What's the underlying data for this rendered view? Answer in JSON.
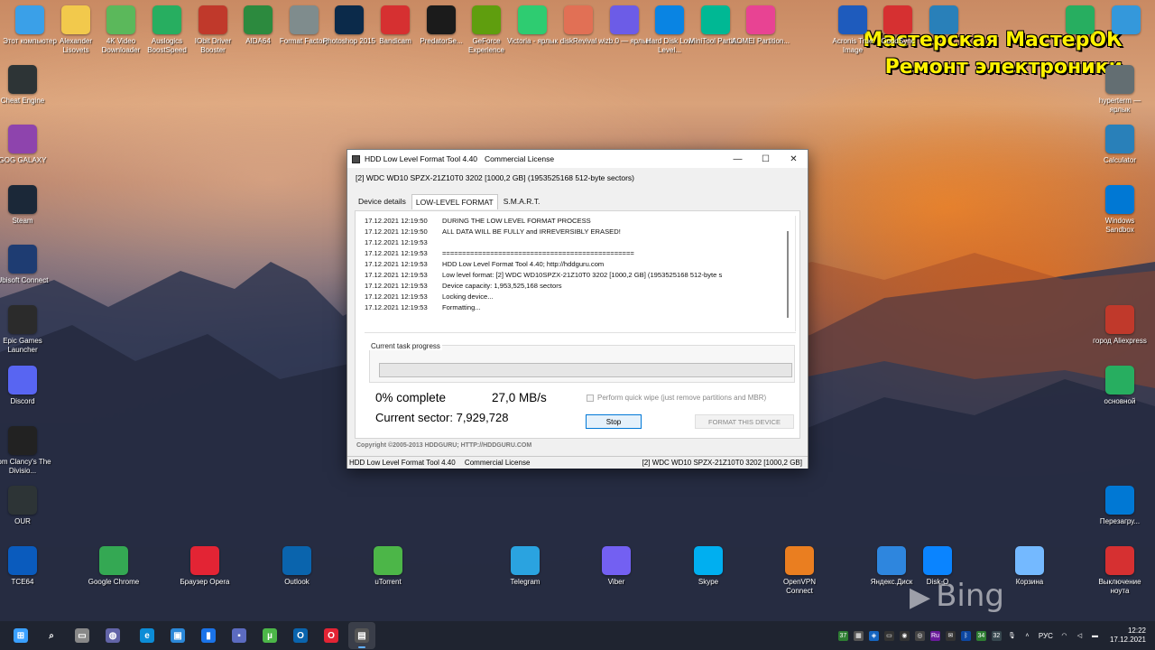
{
  "watermark": {
    "line1": "Мастерская МастерОК",
    "line2": "Ремонт электроники"
  },
  "bing_label": "Bing",
  "desktop_icons": [
    {
      "label": "Этот компьютер",
      "icon": "computer-icon",
      "color": "#3aa0e8"
    },
    {
      "label": "Alexander Lisovets",
      "icon": "folder-icon",
      "color": "#f2c94c"
    },
    {
      "label": "4K Video Downloader",
      "icon": "download-icon",
      "color": "#5bb85b"
    },
    {
      "label": "Auslogics BoostSpeed",
      "icon": "gauge-icon",
      "color": "#27ae60"
    },
    {
      "label": "IObit Driver Booster",
      "icon": "driver-icon",
      "color": "#c0392b"
    },
    {
      "label": "AIDA64",
      "icon": "aida-icon",
      "color": "#2c8a3e"
    },
    {
      "label": "Format Factory",
      "icon": "factory-icon",
      "color": "#7f8c8d"
    },
    {
      "label": "Photoshop 2015",
      "icon": "photoshop-icon",
      "color": "#0b2a4a"
    },
    {
      "label": "Bandicam",
      "icon": "bandicam-icon",
      "color": "#d63031"
    },
    {
      "label": "PredatorSe...",
      "icon": "predator-icon",
      "color": "#1b1b1b"
    },
    {
      "label": "GeForce Experience",
      "icon": "nvidia-icon",
      "color": "#5f9e0e"
    },
    {
      "label": "Victoria - ярлык",
      "icon": "cross-icon",
      "color": "#2ecc71"
    },
    {
      "label": "diskRevival",
      "icon": "disk-revival-icon",
      "color": "#e17055"
    },
    {
      "label": "wizb.0 — ярлык",
      "icon": "wizard-icon",
      "color": "#6c5ce7"
    },
    {
      "label": "Hard Disk Low Level...",
      "icon": "hdd-icon",
      "color": "#0984e3"
    },
    {
      "label": "MiniTool Partiti...",
      "icon": "minitool-icon",
      "color": "#00b894"
    },
    {
      "label": "AOMEI Partition...",
      "icon": "aomei-icon",
      "color": "#e84393"
    },
    {
      "label": "Acronis True Image",
      "icon": "acronis-icon",
      "color": "#1e5bbd"
    },
    {
      "label": "GoodSync",
      "icon": "goodsync-icon",
      "color": "#d63031"
    },
    {
      "label": "",
      "icon": "folder-blue-icon",
      "color": "#2980b9"
    },
    {
      "label": "",
      "icon": "file-green-icon",
      "color": "#27ae60"
    },
    {
      "label": "",
      "icon": "control-icon",
      "color": "#3498db"
    }
  ],
  "left_icons": [
    {
      "label": "Cheat Engine",
      "icon": "cheat-engine-icon",
      "color": "#2d3436"
    },
    {
      "label": "GOG GALAXY",
      "icon": "gog-icon",
      "color": "#8e44ad"
    },
    {
      "label": "Steam",
      "icon": "steam-icon",
      "color": "#1b2838"
    },
    {
      "label": "Ubisoft Connect",
      "icon": "ubisoft-icon",
      "color": "#1e3c72"
    },
    {
      "label": "Epic Games Launcher",
      "icon": "epic-icon",
      "color": "#2b2b2b"
    },
    {
      "label": "Discord",
      "icon": "discord-icon",
      "color": "#5865f2"
    },
    {
      "label": "Tom Clancy's The Divisio...",
      "icon": "division-icon",
      "color": "#222222"
    },
    {
      "label": "OUR",
      "icon": "our-icon",
      "color": "#2d3436"
    },
    {
      "label": "TCE64",
      "icon": "tce-icon",
      "color": "#0a5bbd"
    }
  ],
  "right_icons": [
    {
      "label": "hyperterm — ярлык",
      "icon": "hyperterm-icon",
      "color": "#636e72"
    },
    {
      "label": "Calculator",
      "icon": "calculator-icon",
      "color": "#2980b9"
    },
    {
      "label": "Windows Sandbox",
      "icon": "sandbox-icon",
      "color": "#0078d4"
    },
    {
      "label": "город Aliexpress",
      "icon": "archive-icon",
      "color": "#c0392b"
    },
    {
      "label": "основной",
      "icon": "archive2-icon",
      "color": "#27ae60"
    },
    {
      "label": "Перезагру...",
      "icon": "power-icon",
      "color": "#0078d4"
    },
    {
      "label": "Выключение ноута",
      "icon": "shutdown-icon",
      "color": "#d63031"
    }
  ],
  "bottom_icons": [
    {
      "label": "Google Chrome",
      "icon": "chrome-icon",
      "color": "#34a853"
    },
    {
      "label": "Браузер Opera",
      "icon": "opera-icon",
      "color": "#e32434"
    },
    {
      "label": "Outlook",
      "icon": "outlook-icon",
      "color": "#0a64ad"
    },
    {
      "label": "uTorrent",
      "icon": "utorrent-icon",
      "color": "#4cb648"
    },
    {
      "label": "Telegram",
      "icon": "telegram-icon",
      "color": "#2aa3e0"
    },
    {
      "label": "Viber",
      "icon": "viber-icon",
      "color": "#7360f2"
    },
    {
      "label": "Skype",
      "icon": "skype-icon",
      "color": "#00aff0"
    },
    {
      "label": "OpenVPN Connect",
      "icon": "openvpn-icon",
      "color": "#ea7e20"
    },
    {
      "label": "Яндекс.Диск",
      "icon": "yandex-disk-icon",
      "color": "#2e86de"
    },
    {
      "label": "Disk-O",
      "icon": "disk-o-icon",
      "color": "#0a84ff"
    },
    {
      "label": "Корзина",
      "icon": "recycle-bin-icon",
      "color": "#74b9ff"
    }
  ],
  "window": {
    "title": "HDD Low Level Format Tool 4.40",
    "license": "Commercial License",
    "device_line": "[2]  WDC WD10 SPZX-21Z10T0    3202    [1000,2 GB]    (1953525168 512-byte sectors)",
    "tabs": [
      "Device details",
      "LOW-LEVEL FORMAT",
      "S.M.A.R.T."
    ],
    "active_tab": "LOW-LEVEL FORMAT",
    "log": [
      {
        "ts": "17.12.2021 12:19:50",
        "msg": "DURING THE LOW LEVEL FORMAT PROCESS"
      },
      {
        "ts": "17.12.2021 12:19:50",
        "msg": "ALL DATA WILL BE FULLY and IRREVERSIBLY ERASED!"
      },
      {
        "ts": "17.12.2021 12:19:53",
        "msg": ""
      },
      {
        "ts": "17.12.2021 12:19:53",
        "msg": "================================================"
      },
      {
        "ts": "17.12.2021 12:19:53",
        "msg": "HDD Low Level Format Tool 4.40; http://hddguru.com"
      },
      {
        "ts": "17.12.2021 12:19:53",
        "msg": "Low level format: [2]  WDC WD10SPZX-21Z10T0    3202    [1000,2 GB]    (1953525168 512-byte s"
      },
      {
        "ts": "17.12.2021 12:19:53",
        "msg": "Device capacity: 1,953,525,168 sectors"
      },
      {
        "ts": "17.12.2021 12:19:53",
        "msg": "Locking device..."
      },
      {
        "ts": "17.12.2021 12:19:53",
        "msg": "Formatting..."
      }
    ],
    "progress_label": "Current task progress",
    "progress_fraction": 0.0,
    "complete_text": "0% complete",
    "speed_text": "27,0 MB/s",
    "sector_text": "Current sector: 7,929,728",
    "quick_wipe_label": "Perform quick wipe (just remove partitions and MBR)",
    "stop_label": "Stop",
    "format_label": "FORMAT THIS DEVICE",
    "copyright": "Copyright ©2005-2013 HDDGURU;   HTTP://HDDGURU.COM",
    "status_left_title": "HDD Low Level Format Tool 4.40",
    "status_left_license": "Commercial License",
    "status_right": "[2]  WDC WD10 SPZX-21Z10T0    3202    [1000,2 GB]"
  },
  "taskbar": {
    "apps": [
      {
        "name": "start-button",
        "icon": "windows-icon",
        "color": "#3aa0ff",
        "glyph": "⊞"
      },
      {
        "name": "search-button",
        "icon": "search-icon",
        "color": "transparent",
        "glyph": "⌕"
      },
      {
        "name": "task-view-button",
        "icon": "task-view-icon",
        "color": "#888",
        "glyph": "▭"
      },
      {
        "name": "teams-button",
        "icon": "chat-icon",
        "color": "#6264a7",
        "glyph": "◍"
      },
      {
        "name": "edge-button",
        "icon": "edge-icon",
        "color": "#0c8cd6",
        "glyph": "e"
      },
      {
        "name": "store-button",
        "icon": "store-icon",
        "color": "#2b88d8",
        "glyph": "▣"
      },
      {
        "name": "files-button",
        "icon": "file-explorer-icon",
        "color": "#1a73e8",
        "glyph": "▮"
      },
      {
        "name": "floppy-button",
        "icon": "floppy-icon",
        "color": "#5c6bc0",
        "glyph": "▪"
      },
      {
        "name": "utorrent-task-button",
        "icon": "utorrent-icon",
        "color": "#4cb648",
        "glyph": "µ"
      },
      {
        "name": "outlook-task-button",
        "icon": "outlook-icon",
        "color": "#0a64ad",
        "glyph": "O"
      },
      {
        "name": "opera-task-button",
        "icon": "opera-icon",
        "color": "#e32434",
        "glyph": "O"
      },
      {
        "name": "hddtool-task-button",
        "icon": "hdd-tool-icon",
        "color": "#555",
        "glyph": "▤"
      }
    ],
    "tray": {
      "badges": [
        "37",
        "34",
        "32"
      ],
      "lang": "РУС",
      "time": "12:22",
      "date": "17.12.2021"
    }
  }
}
